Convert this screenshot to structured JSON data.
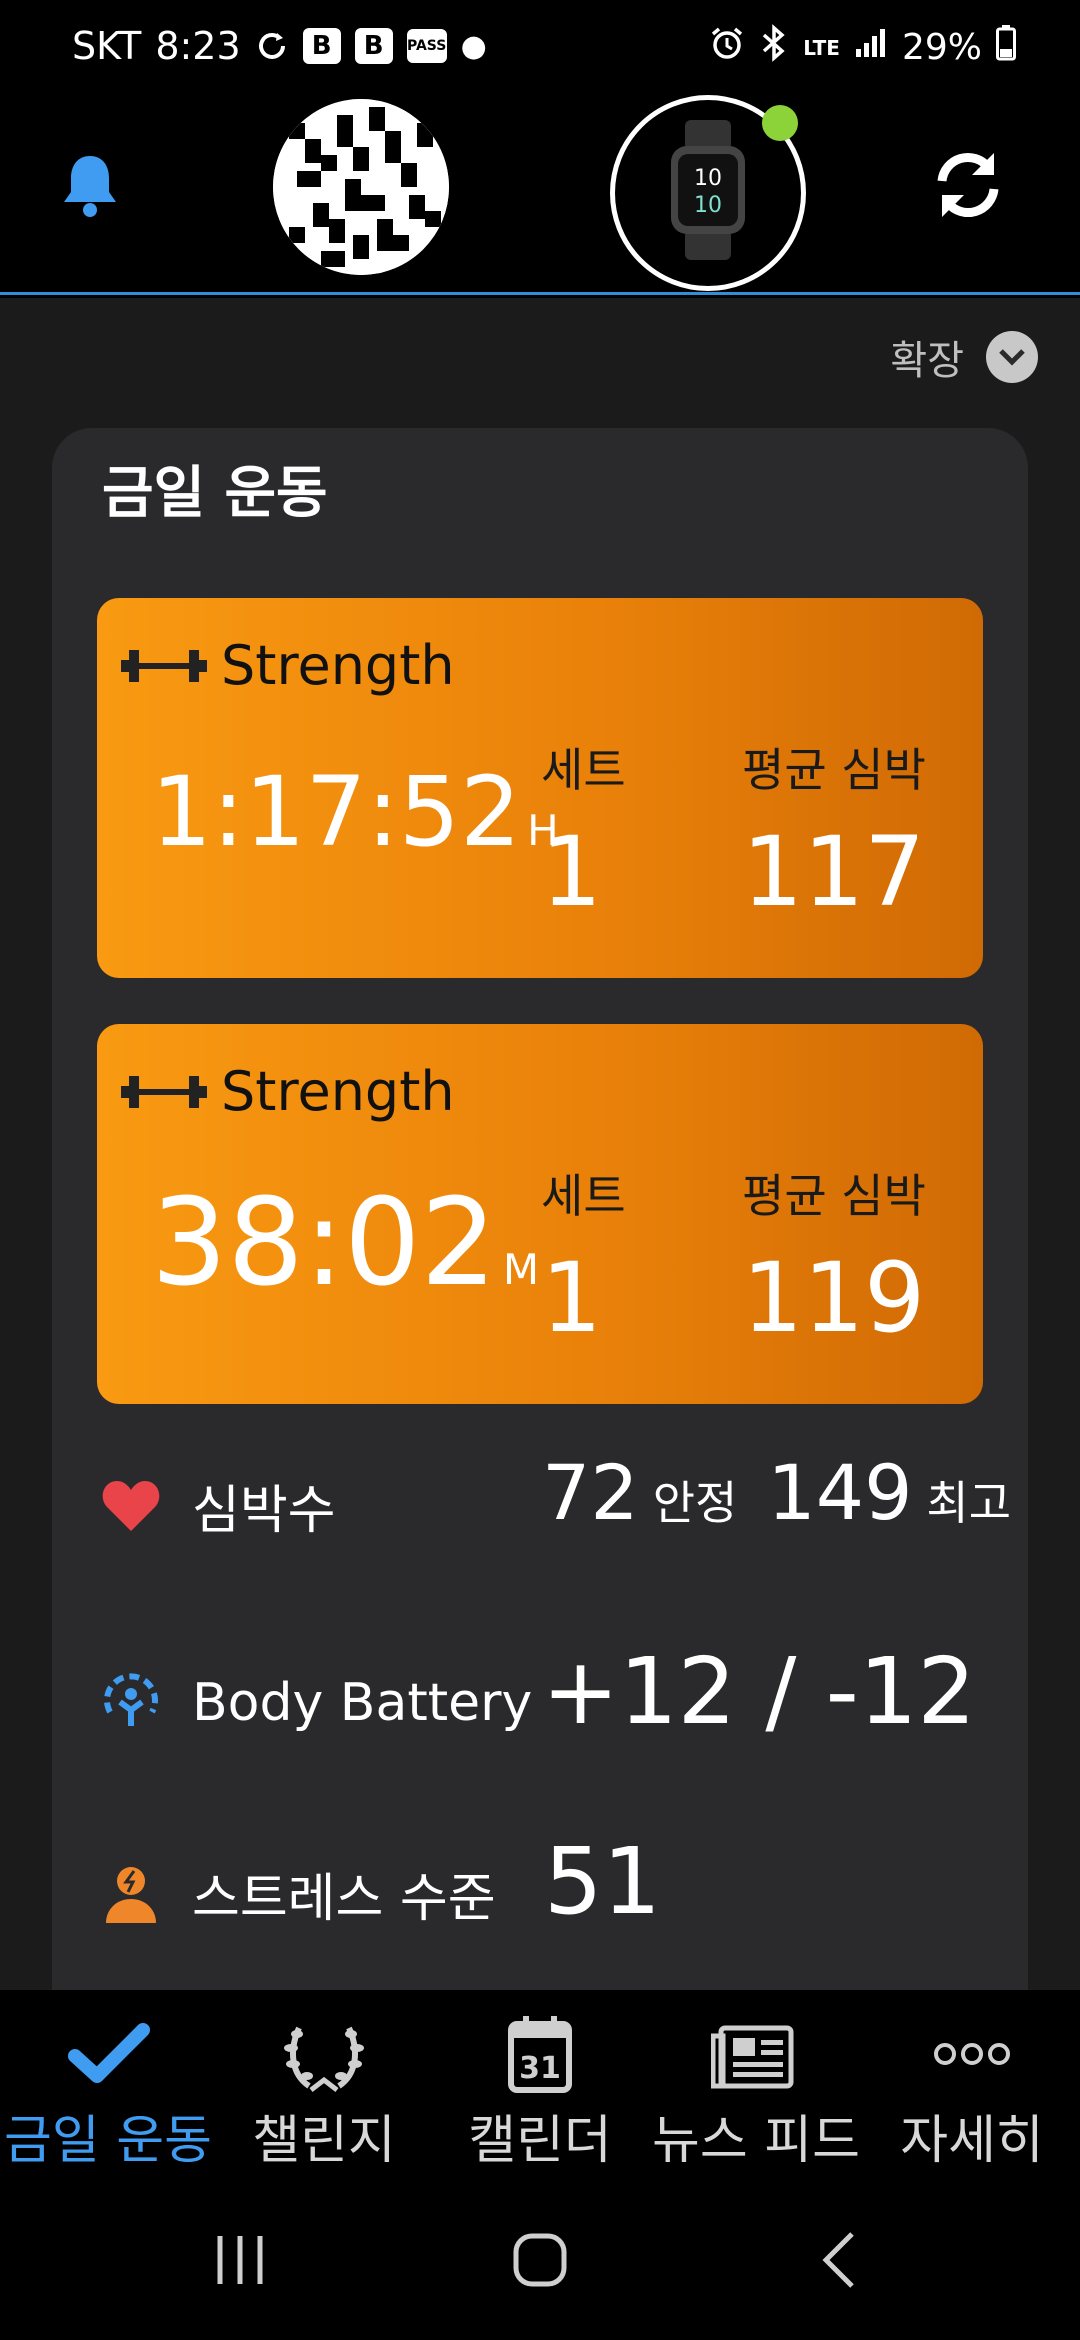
{
  "status_bar": {
    "carrier": "SKT",
    "time": "8:23",
    "icons": [
      "sync-icon",
      "b-app-icon",
      "b-app-icon",
      "pass-app-icon",
      "dot-icon"
    ],
    "pass_label": "PASS",
    "b_label": "B",
    "network": "LTE",
    "battery": "29%"
  },
  "header": {
    "bell_icon": "bell-icon",
    "avatar": "profile-avatar",
    "device": "watch-device",
    "device_status_color": "#8cd33a",
    "sync_icon": "sync-icon",
    "watch_face_time": "10 10"
  },
  "expand": {
    "label": "확장",
    "icon": "chevron-down-icon"
  },
  "card": {
    "title": "금일 운동"
  },
  "activities": [
    {
      "type": "Strength",
      "duration": "1:17:52",
      "unit": "H",
      "sets_label": "세트",
      "sets": "1",
      "hr_label": "평균 심박",
      "avg_hr": "117"
    },
    {
      "type": "Strength",
      "duration": "38:02",
      "unit": "M",
      "sets_label": "세트",
      "sets": "1",
      "hr_label": "평균 심박",
      "avg_hr": "119"
    }
  ],
  "metrics": {
    "heart": {
      "label": "심박수",
      "resting": "72",
      "resting_label": "안정",
      "max": "149",
      "max_label": "최고"
    },
    "body_battery": {
      "label": "Body Battery",
      "value": "+12 / -12"
    },
    "stress": {
      "label": "스트레스 수준",
      "value": "51"
    }
  },
  "bottom_nav": [
    {
      "label": "금일 운동",
      "icon": "checkmark-icon",
      "active": true
    },
    {
      "label": "챌린지",
      "icon": "laurel-icon",
      "active": false
    },
    {
      "label": "캘린더",
      "icon": "calendar-icon",
      "active": false,
      "icon_text": "31"
    },
    {
      "label": "뉴스 피드",
      "icon": "newsfeed-icon",
      "active": false
    },
    {
      "label": "자세히",
      "icon": "more-icon",
      "active": false
    }
  ],
  "colors": {
    "accent": "#3f9cf0",
    "activity_orange": "#f99a12",
    "heart": "#e8444a",
    "battery": "#3f9cf0",
    "stress": "#f0862a"
  }
}
